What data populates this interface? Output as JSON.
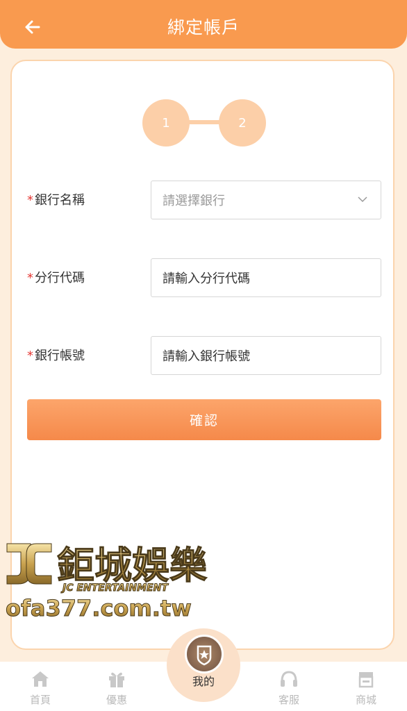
{
  "header": {
    "title": "綁定帳戶"
  },
  "steps": [
    "1",
    "2"
  ],
  "form": {
    "required_mark": "*",
    "bank_name": {
      "label": "銀行名稱",
      "placeholder": "請選擇銀行"
    },
    "branch_code": {
      "label": "分行代碼",
      "placeholder": "請輸入分行代碼"
    },
    "account_number": {
      "label": "銀行帳號",
      "placeholder": "請輸入銀行帳號"
    },
    "confirm_label": "確認"
  },
  "watermark": {
    "brand": "鉅城娛樂",
    "sub": "JC ENTERTAINMENT",
    "url": "ofa377.com.tw"
  },
  "tabbar": {
    "items": [
      {
        "label": "首頁",
        "icon": "home-icon"
      },
      {
        "label": "優惠",
        "icon": "gift-icon"
      },
      {
        "label": "我的",
        "icon": "badge-star-icon"
      },
      {
        "label": "客服",
        "icon": "headset-icon"
      },
      {
        "label": "商城",
        "icon": "store-icon"
      }
    ],
    "active": "我的"
  },
  "colors": {
    "accent": "#f99a4f",
    "step": "#fccfa8",
    "background": "#fdeedd",
    "required": "#e53935"
  }
}
